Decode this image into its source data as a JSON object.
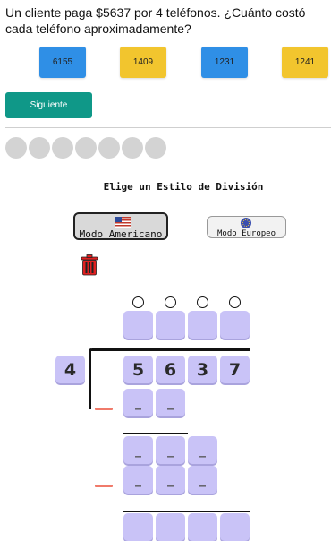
{
  "question": "Un cliente paga $5637 por 4 teléfonos. ¿Cuánto costó cada teléfono aproximadamente?",
  "options": [
    {
      "label": "6155",
      "color": "#2f8fe6"
    },
    {
      "label": "1409",
      "color": "#f2c52e"
    },
    {
      "label": "1231",
      "color": "#2f8fe6"
    },
    {
      "label": "1241",
      "color": "#f2c52e"
    }
  ],
  "next_label": "Siguiente",
  "progress_dots": 7,
  "division_style": {
    "title": "Elige un Estilo de División",
    "american_label": "Modo Americano",
    "european_label": "Modo Europeo",
    "selected": "american"
  },
  "division": {
    "divisor": "4",
    "dividend_digits": [
      "5",
      "6",
      "3",
      "7"
    ],
    "quotient_placeholders": [
      "",
      "",
      "",
      ""
    ],
    "row1": [
      "_",
      "_"
    ],
    "row2": [
      "_",
      "_",
      "_"
    ],
    "row3": [
      "_",
      "_",
      "_"
    ]
  },
  "colors": {
    "accent_green": "#0f9888",
    "cell_purple": "#c9c3f7",
    "minus_red": "#f07a6a",
    "trash_red": "#e02020"
  },
  "icons": [
    "us-flag-icon",
    "eu-flag-icon",
    "trash-icon"
  ]
}
